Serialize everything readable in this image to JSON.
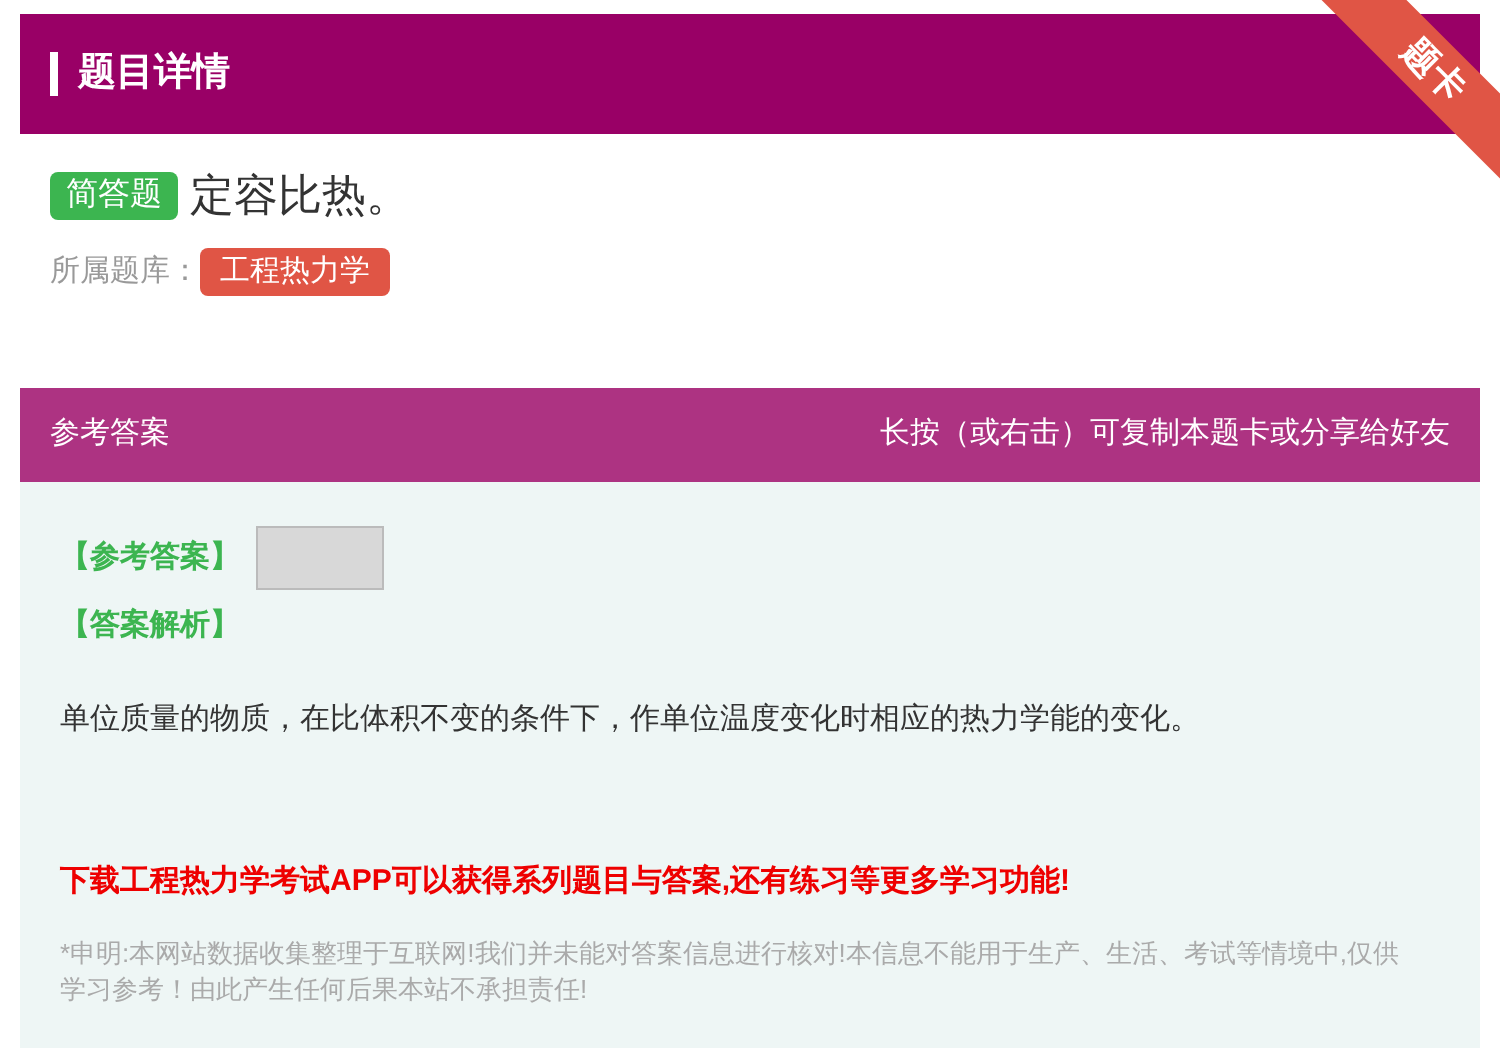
{
  "header": {
    "title": "题目详情",
    "ribbon": "题卡"
  },
  "question": {
    "type_badge": "简答题",
    "text": "定容比热。",
    "library_label": "所属题库：",
    "library_tag": "工程热力学"
  },
  "answer_panel": {
    "title": "参考答案",
    "hint": "长按（或右击）可复制本题卡或分享给好友",
    "answer_label": "【参考答案】",
    "analysis_label": "【答案解析】",
    "analysis_text": "单位质量的物质，在比体积不变的条件下，作单位温度变化时相应的热力学能的变化。",
    "promo": "下载工程热力学考试APP可以获得系列题目与答案,还有练习等更多学习功能!",
    "disclaimer": "*申明:本网站数据收集整理于互联网!我们并未能对答案信息进行核对!本信息不能用于生产、生活、考试等情境中,仅供学习参考！由此产生任何后果本站不承担责任!"
  }
}
